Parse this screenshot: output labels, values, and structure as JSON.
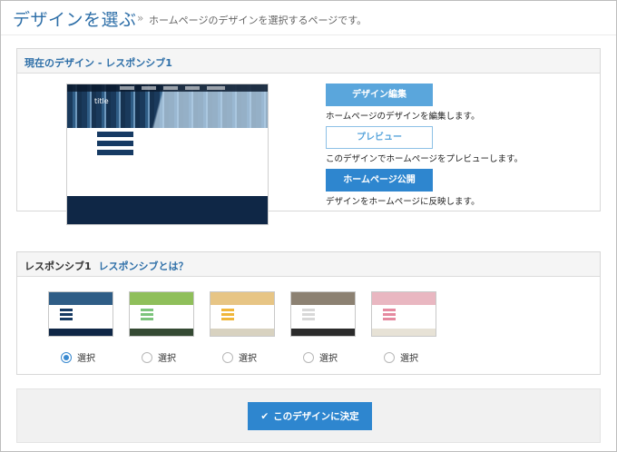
{
  "header": {
    "title": "デザインを選ぶ",
    "separator": "»",
    "subtitle": "ホームページのデザインを選択するページです。"
  },
  "current": {
    "heading": "現在のデザイン - レスポンシブ1",
    "preview_logo": "title",
    "actions": [
      {
        "label": "デザイン編集",
        "desc": "ホームページのデザインを編集します。"
      },
      {
        "label": "プレビュー",
        "desc": "このデザインでホームページをプレビューします。"
      },
      {
        "label": "ホームページ公開",
        "desc": "デザインをホームページに反映します。"
      }
    ]
  },
  "templates": {
    "heading": "レスポンシブ1",
    "link": "レスポンシブとは？",
    "radio_label": "選択",
    "selected_index": 0,
    "items": [
      {
        "theme": "city",
        "hero": "#2f5d86",
        "accent": "#163a63",
        "foot": "#0f2746"
      },
      {
        "theme": "meadow",
        "hero": "#8fbf5a",
        "accent": "#7cc47c",
        "foot": "#354a33"
      },
      {
        "theme": "fruits",
        "hero": "#e7c585",
        "accent": "#f0b63a",
        "foot": "#d8d2c0"
      },
      {
        "theme": "stones",
        "hero": "#8c8172",
        "accent": "#d8d8d8",
        "foot": "#2b2b2b"
      },
      {
        "theme": "flowers",
        "hero": "#e9b7c1",
        "accent": "#e58aa0",
        "foot": "#e7e2d6"
      }
    ]
  },
  "footer": {
    "check_icon": "✔",
    "decide_label": "このデザインに決定"
  },
  "colors": {
    "accent": "#2e86cf",
    "title": "#2e6fa8",
    "light_button": "#5aa6dc"
  }
}
